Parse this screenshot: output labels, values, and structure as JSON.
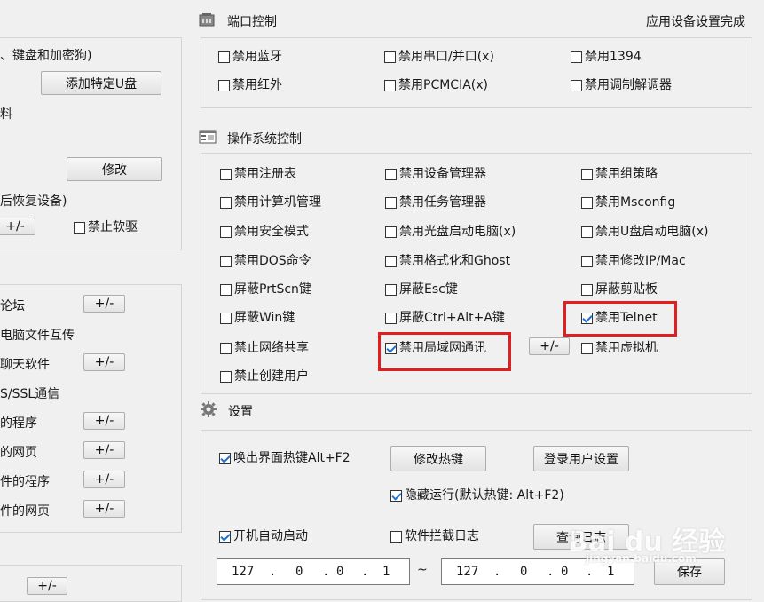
{
  "status": "应用设备设置完成",
  "left": {
    "top_partial": "、键盘和加密狗)",
    "add_usb_button": "添加特定U盘",
    "partial_1": "料",
    "modify_button": "修改",
    "partial_2": "后恢复设备)",
    "plusminus": "+/-",
    "disable_soft_drive": "禁止软驱",
    "list": [
      {
        "text": "论坛",
        "has_button": true
      },
      {
        "text": "电脑文件互传",
        "has_button": false
      },
      {
        "text": "聊天软件",
        "has_button": true
      },
      {
        "text": "S/SSL通信",
        "has_button": false
      },
      {
        "text": "的程序",
        "has_button": true
      },
      {
        "text": "的网页",
        "has_button": true
      },
      {
        "text": "件的程序",
        "has_button": true
      },
      {
        "text": "件的网页",
        "has_button": true
      }
    ],
    "bottom_button": "+/-"
  },
  "port": {
    "title": "端口控制",
    "items": [
      {
        "label": "禁用蓝牙",
        "checked": false
      },
      {
        "label": "禁用串口/并口(x)",
        "checked": false
      },
      {
        "label": "禁用1394",
        "checked": false
      },
      {
        "label": "禁用红外",
        "checked": false
      },
      {
        "label": "禁用PCMCIA(x)",
        "checked": false
      },
      {
        "label": "禁用调制解调器",
        "checked": false
      }
    ]
  },
  "os": {
    "title": "操作系统控制",
    "items": [
      {
        "label": "禁用注册表",
        "checked": false
      },
      {
        "label": "禁用设备管理器",
        "checked": false
      },
      {
        "label": "禁用组策略",
        "checked": false
      },
      {
        "label": "禁用计算机管理",
        "checked": false
      },
      {
        "label": "禁用任务管理器",
        "checked": false
      },
      {
        "label": "禁用Msconfig",
        "checked": false
      },
      {
        "label": "禁用安全模式",
        "checked": false
      },
      {
        "label": "禁用光盘启动电脑(x)",
        "checked": false
      },
      {
        "label": "禁用U盘启动电脑(x)",
        "checked": false
      },
      {
        "label": "禁用DOS命令",
        "checked": false
      },
      {
        "label": "禁用格式化和Ghost",
        "checked": false
      },
      {
        "label": "禁用修改IP/Mac",
        "checked": false
      },
      {
        "label": "屏蔽PrtScn键",
        "checked": false
      },
      {
        "label": "屏蔽Esc键",
        "checked": false
      },
      {
        "label": "屏蔽剪贴板",
        "checked": false
      },
      {
        "label": "屏蔽Win键",
        "checked": false
      },
      {
        "label": "屏蔽Ctrl+Alt+A键",
        "checked": false
      },
      {
        "label": "禁用Telnet",
        "checked": true
      },
      {
        "label": "禁止网络共享",
        "checked": false
      },
      {
        "label": "禁用局域网通讯",
        "checked": true
      },
      {
        "label": "禁用虚拟机",
        "checked": false
      },
      {
        "label": "禁止创建用户",
        "checked": false
      }
    ],
    "lan_button": "+/-"
  },
  "settings": {
    "title": "设置",
    "hotkey": {
      "label": "唤出界面热键Alt+F2",
      "checked": true
    },
    "modify_hotkey_button": "修改热键",
    "login_settings_button": "登录用户设置",
    "hide_run": {
      "label": "隐藏运行(默认热键: Alt+F2)",
      "checked": true
    },
    "autostart": {
      "label": "开机自动启动",
      "checked": true
    },
    "intercept_log": {
      "label": "软件拦截日志",
      "checked": false
    },
    "query_log_button": "查询日志",
    "ip_start": [
      "127",
      "0",
      "0",
      "1"
    ],
    "ip_sep": "~",
    "ip_end": [
      "127",
      "0",
      "0",
      "1"
    ],
    "save_button": "保存"
  },
  "watermark": {
    "main": "Bai du 经验",
    "sub": "jingyan.baidu.com"
  }
}
